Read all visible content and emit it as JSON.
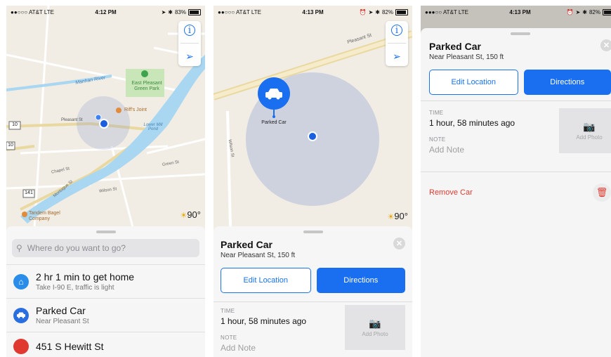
{
  "screens": [
    {
      "status": {
        "carrier": "●●○○○ AT&T  LTE",
        "time": "4:12 PM",
        "battery": "83%"
      },
      "map_labels": {
        "river": "Manhan River",
        "park": "East Pleasant Green Park",
        "pleasant_st": "Pleasant St",
        "joint": "Riff's Joint",
        "pond": "Lower Mill Pond",
        "chapel": "Chapel St",
        "montague": "Montague St",
        "wilson": "Wilson St",
        "green": "Green St",
        "route10": "10",
        "route10b": "10",
        "route141": "141",
        "bagel": "Tandem Bagel Company"
      },
      "weather": "90°",
      "search_placeholder": "Where do you want to go?",
      "list": [
        {
          "title": "2 hr 1 min to get home",
          "subtitle": "Take I-90 E, traffic is light"
        },
        {
          "title": "Parked Car",
          "subtitle": "Near Pleasant St"
        },
        {
          "title": "451 S Hewitt St",
          "subtitle": ""
        }
      ]
    },
    {
      "status": {
        "carrier": "●●○○○ AT&T  LTE",
        "time": "4:13 PM",
        "battery": "82%"
      },
      "map_labels": {
        "pleasant_st": "Pleasant St",
        "wilson": "Wilson St",
        "parked_car_pin": "Parked Car"
      },
      "weather": "90°",
      "card": {
        "title": "Parked Car",
        "subtitle": "Near Pleasant St, 150 ft",
        "edit_label": "Edit Location",
        "directions_label": "Directions",
        "time_label": "TIME",
        "time_value": "1 hour, 58 minutes ago",
        "note_label": "NOTE",
        "note_placeholder": "Add Note",
        "photo_label": "Add Photo"
      }
    },
    {
      "status": {
        "carrier": "●●●○○ AT&T  LTE",
        "time": "4:13 PM",
        "battery": "82%"
      },
      "card": {
        "title": "Parked Car",
        "subtitle": "Near Pleasant St, 150 ft",
        "edit_label": "Edit Location",
        "directions_label": "Directions",
        "time_label": "TIME",
        "time_value": "1 hour, 58 minutes ago",
        "note_label": "NOTE",
        "note_placeholder": "Add Note",
        "photo_label": "Add Photo",
        "remove_label": "Remove Car"
      }
    }
  ],
  "colors": {
    "accent": "#1a6ff0",
    "destructive": "#e0392f",
    "user_dot": "#1a5fe0"
  }
}
